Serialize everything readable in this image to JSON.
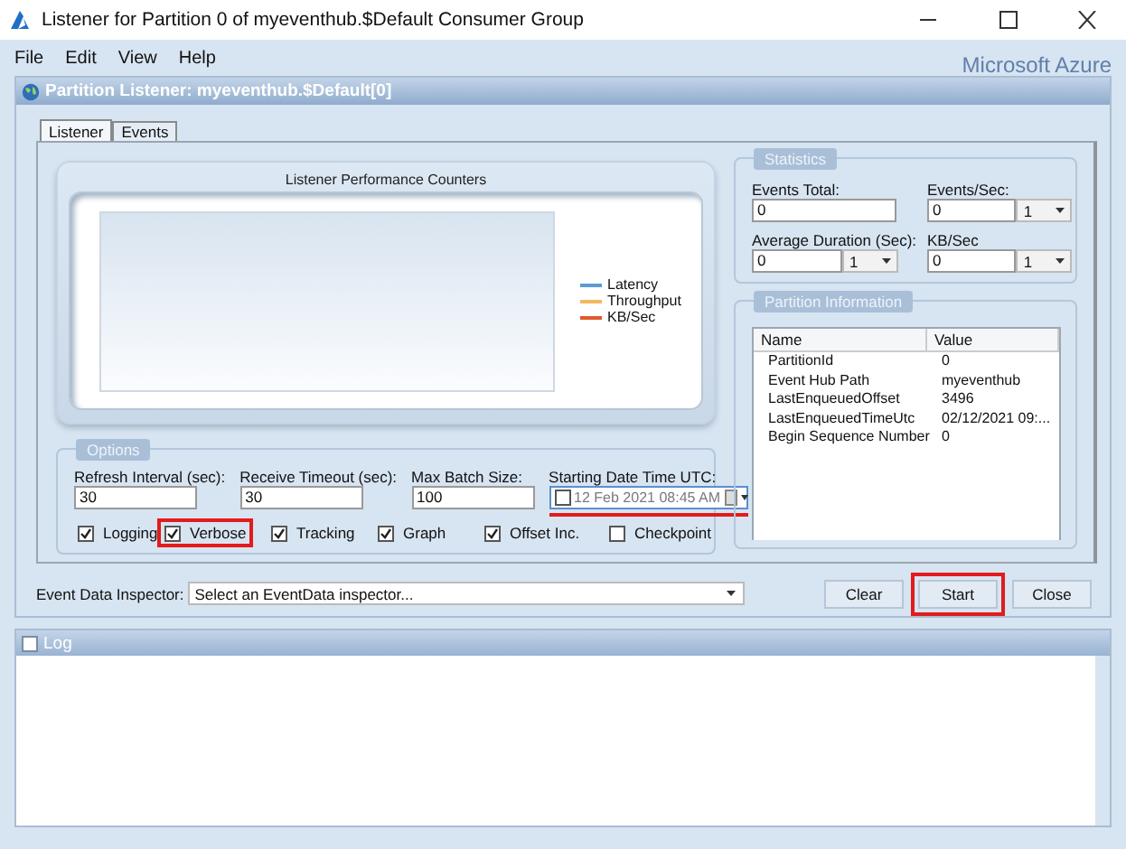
{
  "window": {
    "title": "Listener for Partition 0 of myeventhub.$Default Consumer Group"
  },
  "menu": [
    "File",
    "Edit",
    "View",
    "Help"
  ],
  "brand": "Microsoft Azure",
  "panel": {
    "title": "Partition Listener: myeventhub.$Default[0]"
  },
  "tabs": [
    {
      "label": "Listener",
      "selected": true
    },
    {
      "label": "Events",
      "selected": false
    }
  ],
  "chart": {
    "title": "Listener Performance Counters",
    "legend": [
      {
        "name": "Latency",
        "color": "#5b9bd5"
      },
      {
        "name": "Throughput",
        "color": "#f4b860"
      },
      {
        "name": "KB/Sec",
        "color": "#e0582e"
      }
    ]
  },
  "options": {
    "title": "Options",
    "fields": [
      {
        "label": "Refresh Interval (sec):",
        "kind": "text",
        "value": "30"
      },
      {
        "label": "Receive Timeout (sec):",
        "kind": "text",
        "value": "30"
      },
      {
        "label": "Max Batch Size:",
        "kind": "text",
        "value": "100"
      },
      {
        "label": "Starting Date Time UTC:",
        "kind": "date",
        "value": "12 Feb  2021 08:45 AM",
        "checked": false,
        "underlined": true
      }
    ],
    "checkboxes": [
      {
        "label": "Logging",
        "checked": true,
        "highlighted": false
      },
      {
        "label": "Verbose",
        "checked": true,
        "highlighted": true
      },
      {
        "label": "Tracking",
        "checked": true,
        "highlighted": false
      },
      {
        "label": "Graph",
        "checked": true,
        "highlighted": false
      },
      {
        "label": "Offset Inc.",
        "checked": true,
        "highlighted": false
      },
      {
        "label": "Checkpoint",
        "checked": false,
        "highlighted": false
      }
    ]
  },
  "statistics": {
    "title": "Statistics",
    "fields": [
      {
        "label": "Events Total:",
        "value": "0"
      },
      {
        "label": "Events/Sec:",
        "value": "0",
        "unit": "1"
      },
      {
        "label": "Average Duration (Sec):",
        "value": "0",
        "unit": "1"
      },
      {
        "label": "KB/Sec",
        "value": "0",
        "unit": "1"
      }
    ]
  },
  "partition_information": {
    "title": "Partition Information",
    "columns": [
      "Name",
      "Value"
    ],
    "rows": [
      [
        "PartitionId",
        "0"
      ],
      [
        "Event Hub Path",
        "myeventhub"
      ],
      [
        "LastEnqueuedOffset",
        "3496"
      ],
      [
        "LastEnqueuedTimeUtc",
        "02/12/2021 09:..."
      ],
      [
        "Begin Sequence Number",
        "0"
      ]
    ]
  },
  "inspector": {
    "label": "Event Data Inspector:",
    "value": "Select an EventData inspector..."
  },
  "buttons": [
    {
      "label": "Clear",
      "highlighted": false
    },
    {
      "label": "Start",
      "highlighted": true
    },
    {
      "label": "Close",
      "highlighted": false
    }
  ],
  "log": {
    "title": "Log"
  }
}
